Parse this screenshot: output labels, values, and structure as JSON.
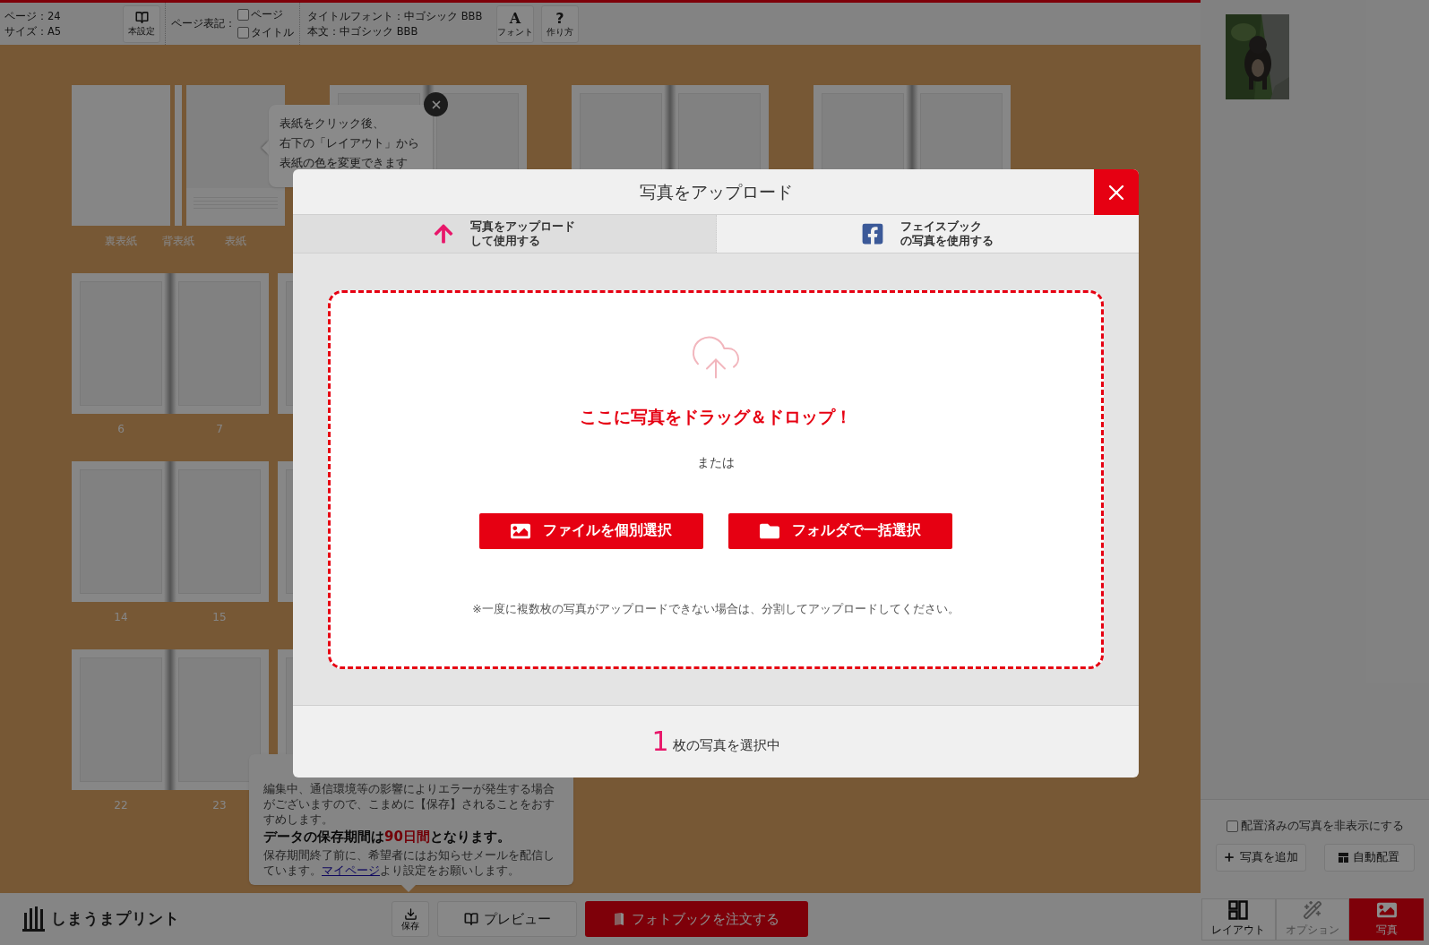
{
  "toolbar": {
    "page_info": [
      "ページ：24",
      "サイズ：A5"
    ],
    "book_settings_button": "本設定",
    "page_notation": {
      "label": "ページ表記：",
      "options": [
        {
          "label": "ページ",
          "checked": false
        },
        {
          "label": "タイトル",
          "checked": false
        }
      ]
    },
    "fonts": [
      "タイトルフォント：中ゴシック BBB",
      "本文：中ゴシック BBB"
    ],
    "buttons": [
      {
        "kind": "font",
        "glyph": "A",
        "label": "フォント"
      },
      {
        "kind": "help",
        "glyph": "?",
        "label": "作り方"
      }
    ]
  },
  "spreads": [
    {
      "kind": "cover",
      "labels": [
        "裏表紙",
        "背表紙",
        "表紙"
      ]
    },
    {
      "kind": "spread",
      "labels": [
        "6",
        "7"
      ]
    },
    {
      "kind": "spread",
      "labels": [
        "14",
        "15"
      ]
    },
    {
      "kind": "spread",
      "labels": [
        "22",
        "23"
      ]
    }
  ],
  "cover_tip": {
    "lines": [
      "表紙をクリック後、",
      "右下の「レイアウト」から",
      "表紙の色を変更できます"
    ]
  },
  "save_tip": {
    "paragraph": "編集中、通信環境等の影響によりエラーが発生する場合がございますので、こまめに【保存】されることをおすすめします。",
    "notice": {
      "before": "データの保存期間は",
      "highlight": "90日間",
      "after": "となります。"
    },
    "footer": {
      "before": "保存期間終了前に、希望者にはお知らせメールを配信しています。",
      "link": "マイページ",
      "after": "より設定をお願いします。"
    }
  },
  "bottom_bar": {
    "logo": "しまうまプリント",
    "save": "保存",
    "preview": "プレビュー",
    "order": "フォトブックを注文する"
  },
  "right_panel": {
    "hide_placed": {
      "label": "配置済みの写真を非表示にする",
      "checked": false
    },
    "buttons": [
      {
        "kind": "add",
        "label": "写真を追加"
      },
      {
        "kind": "auto",
        "label": "自動配置"
      }
    ],
    "tabs": [
      {
        "kind": "layout",
        "label": "レイアウト",
        "selected": false,
        "disabled": false
      },
      {
        "kind": "option",
        "label": "オプション",
        "selected": false,
        "disabled": true
      },
      {
        "label": "写真",
        "selected": true,
        "disabled": false
      }
    ]
  },
  "modal": {
    "title": "写真をアップロード",
    "tabs": [
      {
        "kind": "upload",
        "lines": [
          "写真をアップロード",
          "して使用する"
        ],
        "selected": true
      },
      {
        "kind": "facebook",
        "lines": [
          "フェイスブック",
          "の写真を使用する"
        ],
        "selected": false
      }
    ],
    "heading": "ここに写真をドラッグ＆ドロップ！",
    "or_text": "または",
    "buttons": [
      {
        "kind": "file",
        "label": "ファイルを個別選択"
      },
      {
        "kind": "folder",
        "label": "フォルダで一括選択"
      }
    ],
    "note": "※一度に複数枚の写真がアップロードできない場合は、分割してアップロードしてください。",
    "selection": {
      "count": "1",
      "text": "枚の写真を選択中"
    }
  }
}
